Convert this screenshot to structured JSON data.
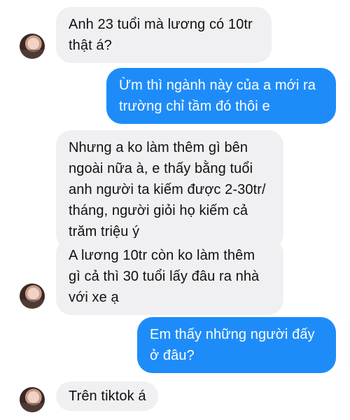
{
  "messages": [
    {
      "sender": "them",
      "text": "Anh 23 tuổi mà lương có 10tr\nthật á?"
    },
    {
      "sender": "me",
      "text": "Ừm thì ngành này của a mới ra\ntrường chỉ tầm đó thôi e"
    },
    {
      "sender": "them",
      "text": "Nhưng a ko làm thêm gì bên\nngoài nữa à, e thấy bằng tuổi\nanh người ta kiếm được 2-30tr/\ntháng, người giỏi họ kiếm cả\ntrăm triệu ý"
    },
    {
      "sender": "them",
      "text": "A lương 10tr còn ko làm thêm\ngì cả thì 30 tuổi lấy đâu ra nhà\nvới xe ạ"
    },
    {
      "sender": "me",
      "text": "Em thấy những người đấy\nở đâu?"
    },
    {
      "sender": "them",
      "text": "Trên tiktok á"
    }
  ],
  "colors": {
    "incoming_bubble": "#f0f0f2",
    "outgoing_bubble": "#1e8cf8",
    "outgoing_text": "#ffffff",
    "incoming_text": "#111111"
  }
}
